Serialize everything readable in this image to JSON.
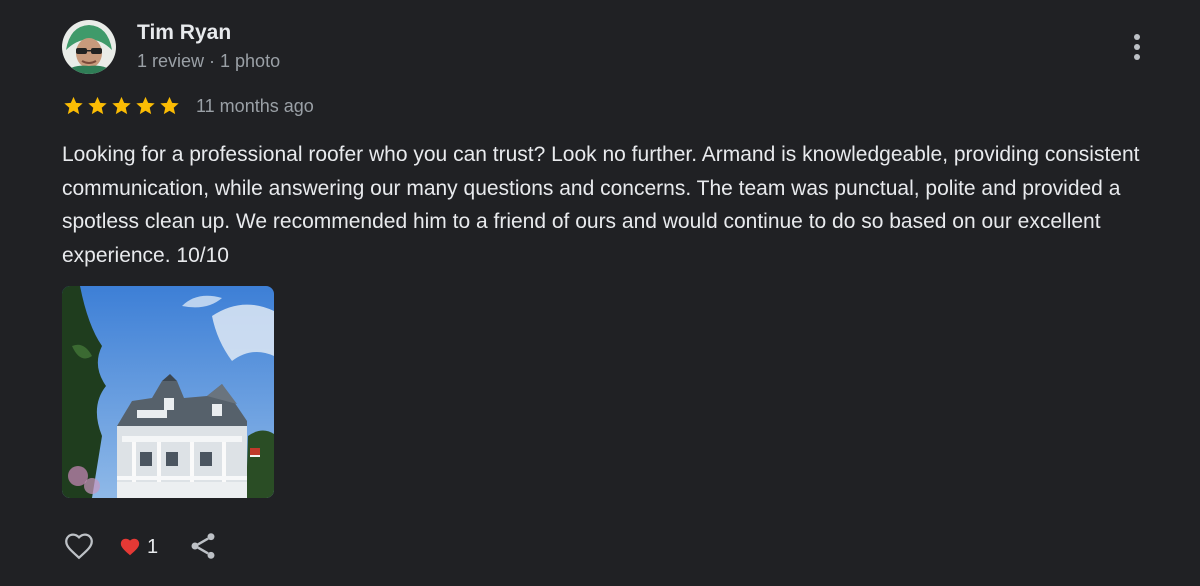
{
  "author": {
    "name": "Tim Ryan",
    "meta": "1 review · 1 photo",
    "avatar_icon": "profile-photo"
  },
  "rating": {
    "stars": 5,
    "max": 5,
    "star_color": "#fbbc04",
    "time_ago": "11 months ago"
  },
  "review": {
    "text": "Looking for a professional roofer who you can trust? Look no further. Armand is knowledgeable, providing consistent communication, while answering our many questions and concerns. The team was punctual, polite and provided a spotless clean up. We recommended him to a friend of ours and would continue to do so based on our excellent experience. 10/10"
  },
  "photos": [
    {
      "icon": "house-photo"
    }
  ],
  "actions": {
    "like_icon": "heart-outline-icon",
    "reaction_icon": "red-heart-emoji",
    "reaction_count": "1",
    "share_icon": "share-icon"
  },
  "colors": {
    "background": "#202124",
    "text_primary": "#e8eaed",
    "text_secondary": "#9aa0a6",
    "star": "#fbbc04",
    "heart": "#e53935"
  }
}
